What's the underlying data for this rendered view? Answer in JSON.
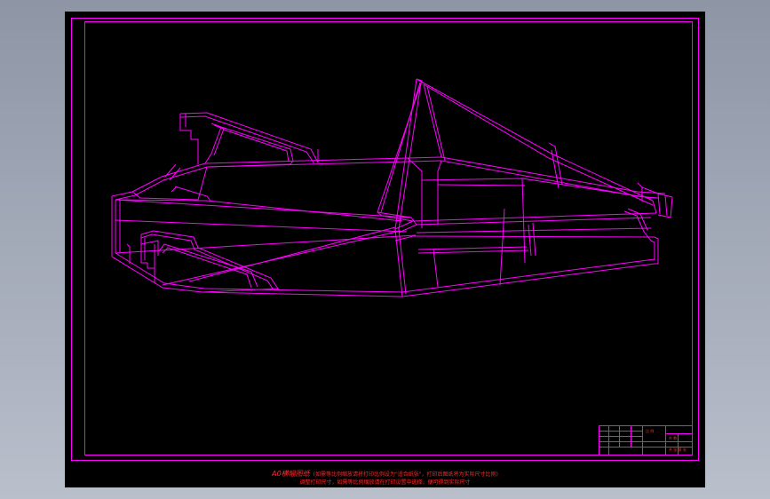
{
  "drawing": {
    "note_title": "A0横幅图纸",
    "note_line1": "(如需等比例缩放请将打印比例设为\"适合纸张\"，打印后图纸将为实际尺寸比例)",
    "note_line2": "调整打印尺寸，如需等比例缩放请在打印设置中选择，便可得到实际尺寸",
    "titleblock_ratio": "比 例",
    "titleblock_qty": "件 数",
    "titleblock_sheet": "共 张 第 张",
    "colors": {
      "background": "#000000",
      "frame": "#ff00ff",
      "note_text": "#ff2a2a",
      "window": "#9aa2b1"
    }
  }
}
